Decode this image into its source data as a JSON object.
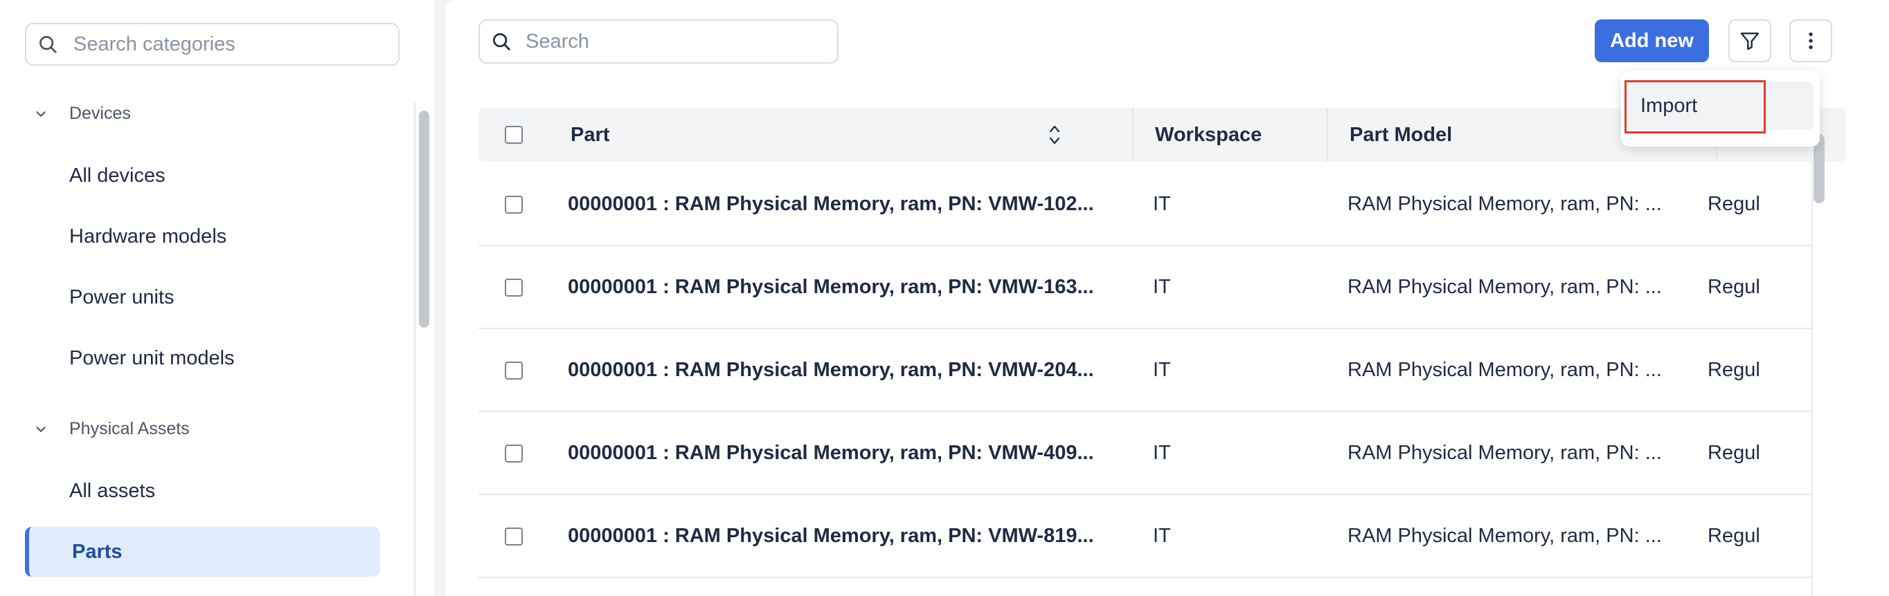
{
  "sidebar": {
    "search_placeholder": "Search categories",
    "sections": [
      {
        "title": "Devices",
        "items": [
          "All devices",
          "Hardware models",
          "Power units",
          "Power unit models"
        ]
      },
      {
        "title": "Physical Assets",
        "items": [
          "All assets",
          "Parts"
        ]
      }
    ],
    "active_item": "Parts"
  },
  "toolbar": {
    "search_placeholder": "Search",
    "add_label": "Add new",
    "filter_icon": "filter-icon",
    "more_icon": "more-vertical-icon"
  },
  "menu": {
    "items": [
      "Import"
    ]
  },
  "table": {
    "columns": [
      "Part",
      "Workspace",
      "Part Model"
    ],
    "rows": [
      {
        "part": "00000001 : RAM Physical Memory, ram, PN: VMW-102...",
        "workspace": "IT",
        "model": "RAM Physical Memory, ram, PN: ...",
        "extra": "Regul"
      },
      {
        "part": "00000001 : RAM Physical Memory, ram, PN: VMW-163...",
        "workspace": "IT",
        "model": "RAM Physical Memory, ram, PN: ...",
        "extra": "Regul"
      },
      {
        "part": "00000001 : RAM Physical Memory, ram, PN: VMW-204...",
        "workspace": "IT",
        "model": "RAM Physical Memory, ram, PN: ...",
        "extra": "Regul"
      },
      {
        "part": "00000001 : RAM Physical Memory, ram, PN: VMW-409...",
        "workspace": "IT",
        "model": "RAM Physical Memory, ram, PN: ...",
        "extra": "Regul"
      },
      {
        "part": "00000001 : RAM Physical Memory, ram, PN: VMW-819...",
        "workspace": "IT",
        "model": "RAM Physical Memory, ram, PN: ...",
        "extra": "Regul"
      }
    ]
  },
  "colors": {
    "accent": "#3b6fe0",
    "active_bg": "#e0ecfb",
    "highlight": "#e03c2c"
  }
}
